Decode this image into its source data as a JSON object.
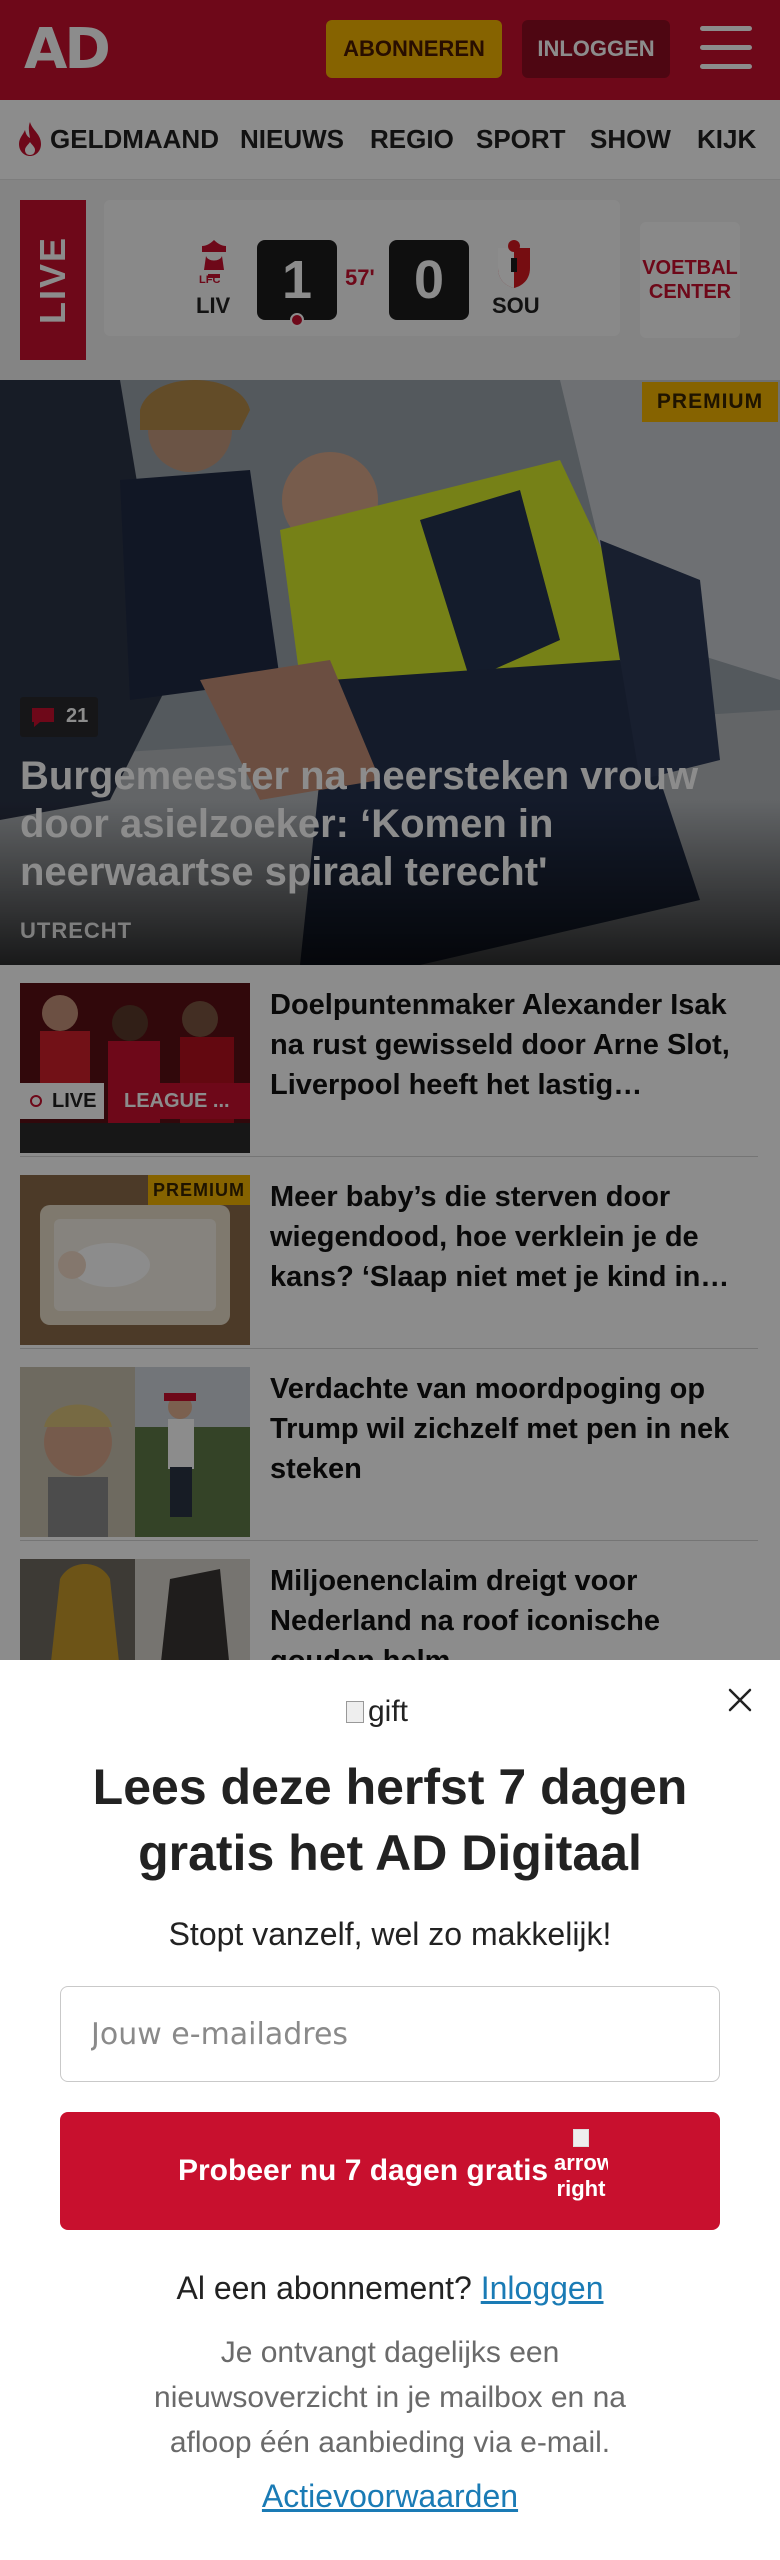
{
  "header": {
    "logo": "AD",
    "subscribe_label": "ABONNEREN",
    "login_label": "INLOGGEN"
  },
  "nav": {
    "items": [
      "GELDMAAND",
      "NIEUWS",
      "REGIO",
      "SPORT",
      "SHOW",
      "KIJK"
    ]
  },
  "live_match": {
    "live_label": "LIVE",
    "home_code": "LIV",
    "home_crest_text": "LFC",
    "away_code": "SOU",
    "home_score": "1",
    "away_score": "0",
    "minute": "57'",
    "voetbal_center": "VOETBAL CENTER"
  },
  "hero": {
    "badge": "PREMIUM",
    "comments": "21",
    "title": "Burgemeester na neersteken vrouw door asielzoeker: ‘Komen in neerwaartse spiraal terecht'",
    "location": "UTRECHT"
  },
  "articles": [
    {
      "title": "Doelpuntenmaker Alexander Isak na rust gewisseld door Arne Slot, Liverpool heeft het lastig…",
      "live_label": "LIVE",
      "league_label": "LEAGUE ..."
    },
    {
      "title": "Meer baby’s die sterven door wiegendood, hoe verklein je de kans? ‘Slaap niet met je kind in…",
      "badge": "PREMIUM"
    },
    {
      "title": "Verdachte van moordpoging op Trump wil zichzelf met pen in nek steken"
    },
    {
      "title": "Miljoenenclaim dreigt voor Nederland na roof iconische gouden helm"
    }
  ],
  "modal": {
    "gift_alt": "gift",
    "title": "Lees deze herfst 7 dagen gratis het AD Digitaal",
    "subtitle": "Stopt vanzelf, wel zo makkelijk!",
    "email_placeholder": "Jouw e-mailadres",
    "cta_label": "Probeer nu 7 dagen gratis",
    "cta_arrow_alt": "arrow right",
    "already_text": "Al een abonnement?",
    "login_link": "Inloggen",
    "info_text": "Je ontvangt dagelijks een nieuwsoverzicht in je mailbox en na afloop één aanbieding via e-mail.",
    "terms_link": "Actievoorwaarden"
  },
  "colors": {
    "brand_red": "#c8102e",
    "subscribe_yellow": "#f5b400",
    "link_blue": "#1a7bb5"
  }
}
